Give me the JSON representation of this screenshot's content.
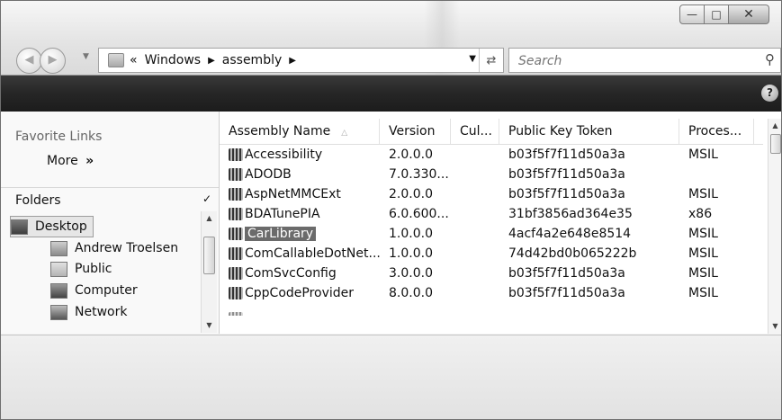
{
  "window": {
    "controls": {
      "minimize_icon": "minimize-icon",
      "maximize_icon": "maximize-icon",
      "close_icon": "close-icon"
    }
  },
  "address_bar": {
    "overflow_marker": "«",
    "crumbs": [
      "Windows",
      "assembly"
    ]
  },
  "search": {
    "placeholder": "Search"
  },
  "command_bar": {
    "help_icon": "help-icon"
  },
  "nav_pane": {
    "favorite_links_header": "Favorite Links",
    "more_label": "More",
    "more_marker": "»",
    "folders_label": "Folders",
    "tree": [
      {
        "label": "Desktop",
        "selected": true,
        "icon": "desktop-icon"
      },
      {
        "label": "Andrew Troelsen",
        "icon": "user-folder-icon"
      },
      {
        "label": "Public",
        "icon": "folder-icon"
      },
      {
        "label": "Computer",
        "icon": "computer-icon"
      },
      {
        "label": "Network",
        "icon": "network-icon"
      }
    ]
  },
  "assembly_list": {
    "columns": [
      "Assembly Name",
      "Version",
      "Cul...",
      "Public Key Token",
      "Proces..."
    ],
    "rows": [
      {
        "name": "Accessibility",
        "version": "2.0.0.0",
        "culture": "",
        "token": "b03f5f7f11d50a3a",
        "processor": "MSIL"
      },
      {
        "name": "ADODB",
        "version": "7.0.330...",
        "culture": "",
        "token": "b03f5f7f11d50a3a",
        "processor": ""
      },
      {
        "name": "AspNetMMCExt",
        "version": "2.0.0.0",
        "culture": "",
        "token": "b03f5f7f11d50a3a",
        "processor": "MSIL"
      },
      {
        "name": "BDATunePIA",
        "version": "6.0.600...",
        "culture": "",
        "token": "31bf3856ad364e35",
        "processor": "x86"
      },
      {
        "name": "CarLibrary",
        "version": "1.0.0.0",
        "culture": "",
        "token": "4acf4a2e648e8514",
        "processor": "MSIL",
        "selected": true
      },
      {
        "name": "ComCallableDotNet...",
        "version": "1.0.0.0",
        "culture": "",
        "token": "74d42bd0b065222b",
        "processor": "MSIL"
      },
      {
        "name": "ComSvcConfig",
        "version": "3.0.0.0",
        "culture": "",
        "token": "b03f5f7f11d50a3a",
        "processor": "MSIL"
      },
      {
        "name": "CppCodeProvider",
        "version": "8.0.0.0",
        "culture": "",
        "token": "b03f5f7f11d50a3a",
        "processor": "MSIL"
      }
    ]
  }
}
